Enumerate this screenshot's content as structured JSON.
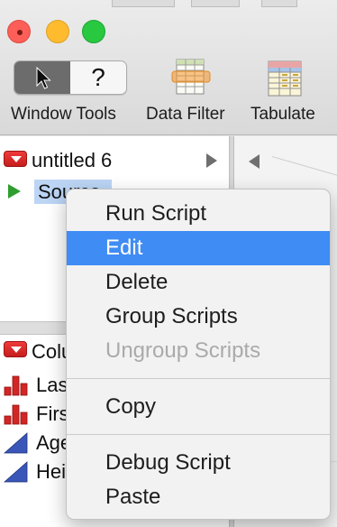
{
  "toolbar": {
    "tools": [
      {
        "label": "Window Tools",
        "icon": "window-tools-icon"
      },
      {
        "label": "Data Filter",
        "icon": "data-filter-icon"
      },
      {
        "label": "Tabulate",
        "icon": "tabulate-icon"
      }
    ],
    "help_glyph": "?"
  },
  "script_panel": {
    "title": "untitled 6",
    "script_name": "Source"
  },
  "columns_panel": {
    "title": "Columns",
    "columns": [
      {
        "name": "Last",
        "type_icon": "nominal-bar-icon"
      },
      {
        "name": "First",
        "type_icon": "nominal-bar-icon"
      },
      {
        "name": "Age",
        "type_icon": "continuous-triangle-icon"
      },
      {
        "name": "Height",
        "type_icon": "continuous-triangle-icon"
      }
    ]
  },
  "context_menu": {
    "items": [
      {
        "label": "Run Script",
        "state": "normal"
      },
      {
        "label": "Edit",
        "state": "selected"
      },
      {
        "label": "Delete",
        "state": "normal"
      },
      {
        "label": "Group Scripts",
        "state": "normal"
      },
      {
        "label": "Ungroup Scripts",
        "state": "disabled"
      },
      {
        "label": "Copy",
        "state": "normal"
      },
      {
        "label": "Debug Script",
        "state": "normal"
      },
      {
        "label": "Paste",
        "state": "normal"
      }
    ]
  },
  "colors": {
    "close": "#fc5f57",
    "minimize": "#febb2e",
    "maximize": "#28c840",
    "menu_highlight": "#3f8cf4",
    "selection": "#bcd5f5",
    "disclosure_red": "#d42525",
    "play_green": "#2f9e2f"
  }
}
